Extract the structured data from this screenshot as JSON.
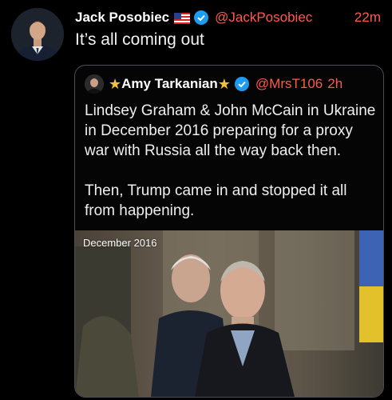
{
  "tweet": {
    "author_name": "Jack Posobiec",
    "flag_icon": "us-flag-icon",
    "verified_icon": "verified-badge-icon",
    "handle": "@JackPosobiec",
    "time": "22m",
    "text": "It’s all coming out"
  },
  "quote": {
    "star_left": "★",
    "author_name": "Amy Tarkanian",
    "star_right": "★",
    "verified_icon": "verified-badge-icon",
    "handle": "@MrsT106",
    "time": "2h",
    "paragraphs": [
      "Lindsey Graham & John McCain in Ukraine in December 2016 preparing for a proxy war with Russia all the way back then.",
      "Then, Trump came in and stopped it all from happening."
    ],
    "media": {
      "caption": "December 2016"
    }
  },
  "colors": {
    "background": "#000000",
    "accent": "#ff5a4a",
    "verified": "#1d9bf0",
    "star": "#f2c230"
  }
}
